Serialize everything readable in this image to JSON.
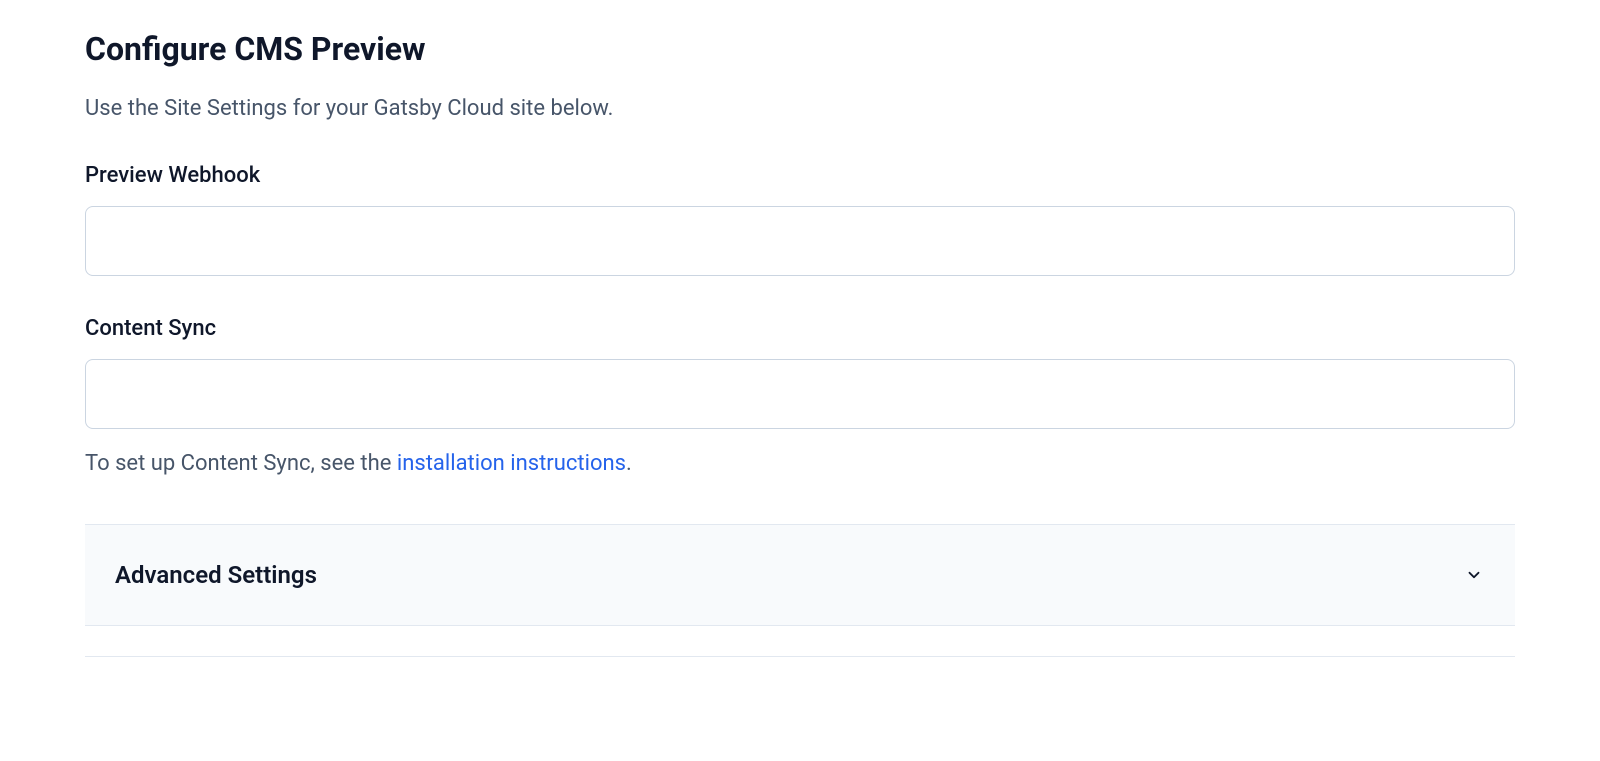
{
  "header": {
    "title": "Configure CMS Preview",
    "subtitle": "Use the Site Settings for your Gatsby Cloud site below."
  },
  "fields": {
    "preview_webhook": {
      "label": "Preview Webhook",
      "value": ""
    },
    "content_sync": {
      "label": "Content Sync",
      "value": "",
      "helper_prefix": "To set up Content Sync, see the ",
      "helper_link": "installation instructions",
      "helper_suffix": "."
    }
  },
  "accordion": {
    "advanced_settings": {
      "label": "Advanced Settings",
      "expanded": false
    }
  }
}
